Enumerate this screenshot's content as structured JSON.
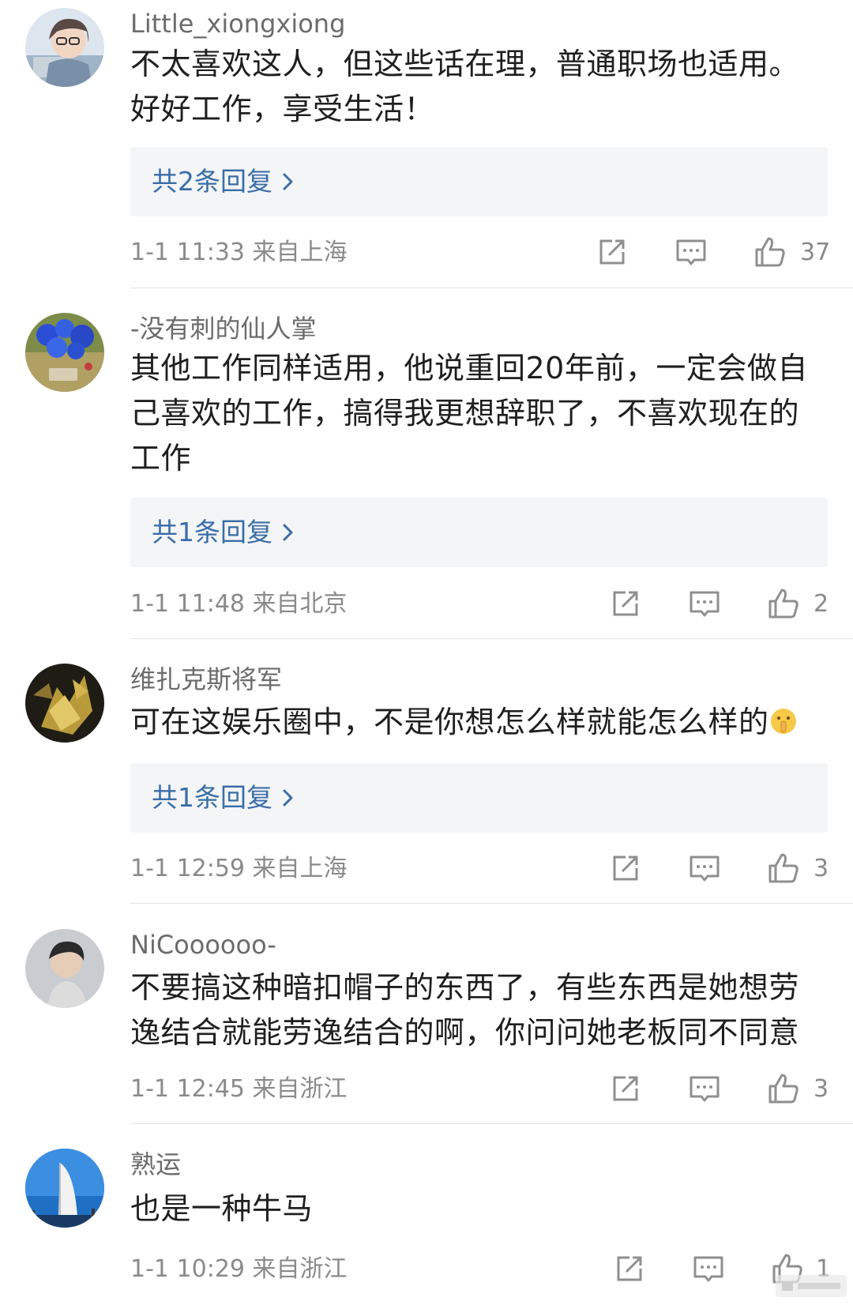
{
  "comments": [
    {
      "username": "Little_xiongxiong",
      "avatar": "avatar-girl-laptop",
      "text": "不太喜欢这人，但这些话在理，普通职场也适用。好好工作，享受生活！",
      "reply_label": "共2条回复",
      "time": "1-1 11:33 来自上海",
      "likes": "37"
    },
    {
      "username": "-没有刺的仙人掌",
      "avatar": "avatar-blue-flowers",
      "text": "其他工作同样适用，他说重回20年前，一定会做自己喜欢的工作，搞得我更想辞职了，不喜欢现在的工作",
      "reply_label": "共1条回复",
      "time": "1-1 11:48 来自北京",
      "likes": "2"
    },
    {
      "username": "维扎克斯将军",
      "avatar": "avatar-gold-mech",
      "text": "可在这娱乐圈中，不是你想怎么样就能怎么样的",
      "emoji": "shushing-face",
      "reply_label": "共1条回复",
      "time": "1-1 12:59 来自上海",
      "likes": "3"
    },
    {
      "username": "NiCoooooo-",
      "avatar": "avatar-man-portrait",
      "text": "不要搞这种暗扣帽子的东西了，有些东西是她想劳逸结合就能劳逸结合的啊，你问问她老板同不同意",
      "time": "1-1 12:45 来自浙江",
      "likes": "3"
    },
    {
      "username": "熟运",
      "avatar": "avatar-burj-al-arab",
      "text": "也是一种牛马",
      "time": "1-1 10:29 来自浙江",
      "likes": "1"
    }
  ],
  "colors": {
    "username": "#6b6b6b",
    "text": "#1f1f1f",
    "reply_link": "#3a6ea8",
    "reply_bg": "#f4f5f7",
    "meta": "#8a8a8a",
    "icon": "#8f8f8f"
  }
}
